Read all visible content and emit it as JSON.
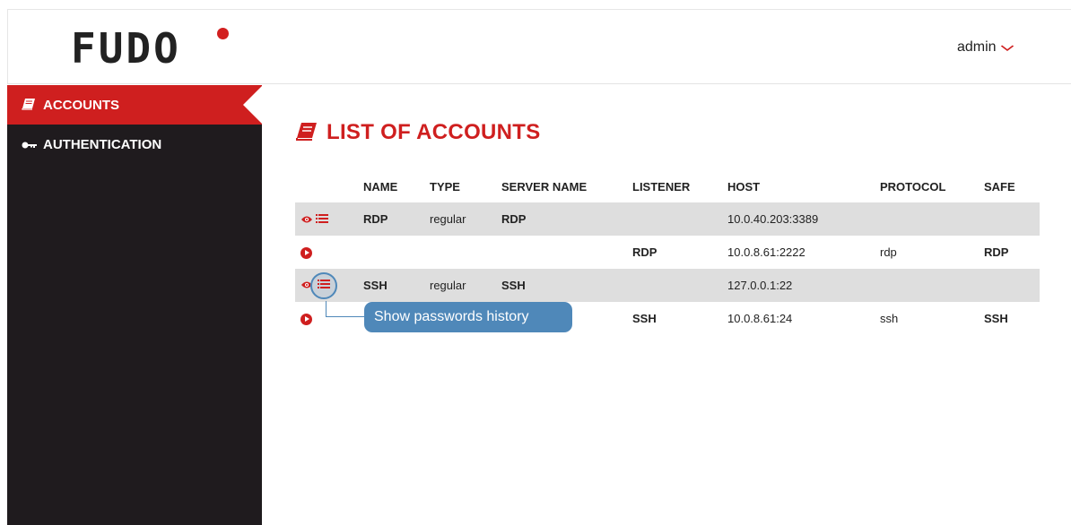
{
  "header": {
    "logo_text": "FUDO",
    "user_label": "admin",
    "user_chevron": "⌄"
  },
  "sidebar": {
    "items": [
      {
        "label": "ACCOUNTS",
        "icon": "book-icon",
        "active": true
      },
      {
        "label": "AUTHENTICATION",
        "icon": "key-icon",
        "active": false
      }
    ]
  },
  "main": {
    "title": "LIST OF ACCOUNTS",
    "title_icon": "book-icon",
    "table": {
      "columns": [
        "NAME",
        "TYPE",
        "SERVER NAME",
        "LISTENER",
        "HOST",
        "PROTOCOL",
        "SAFE"
      ],
      "rows": [
        {
          "actions": [
            "eye-icon",
            "list-icon"
          ],
          "name": "RDP",
          "type": "regular",
          "server_name": "RDP",
          "listener": "",
          "host": "10.0.40.203:3389",
          "protocol": "",
          "safe": ""
        },
        {
          "actions": [
            "play-icon"
          ],
          "name": "",
          "type": "",
          "server_name": "",
          "listener": "RDP",
          "host": "10.0.8.61:2222",
          "protocol": "rdp",
          "safe": "RDP"
        },
        {
          "actions": [
            "eye-icon",
            "list-icon"
          ],
          "name": "SSH",
          "type": "regular",
          "server_name": "SSH",
          "listener": "",
          "host": "127.0.0.1:22",
          "protocol": "",
          "safe": ""
        },
        {
          "actions": [
            "play-icon"
          ],
          "name": "",
          "type": "",
          "server_name": "",
          "listener": "SSH",
          "host": "10.0.8.61:24",
          "protocol": "ssh",
          "safe": "SSH"
        }
      ]
    }
  },
  "tooltip": {
    "text": "Show passwords history"
  },
  "colors": {
    "accent": "#cf1f1f",
    "sidebar_bg": "#1f1b1e",
    "row_shade": "#dedede",
    "tooltip_bg": "#4f88b9"
  }
}
